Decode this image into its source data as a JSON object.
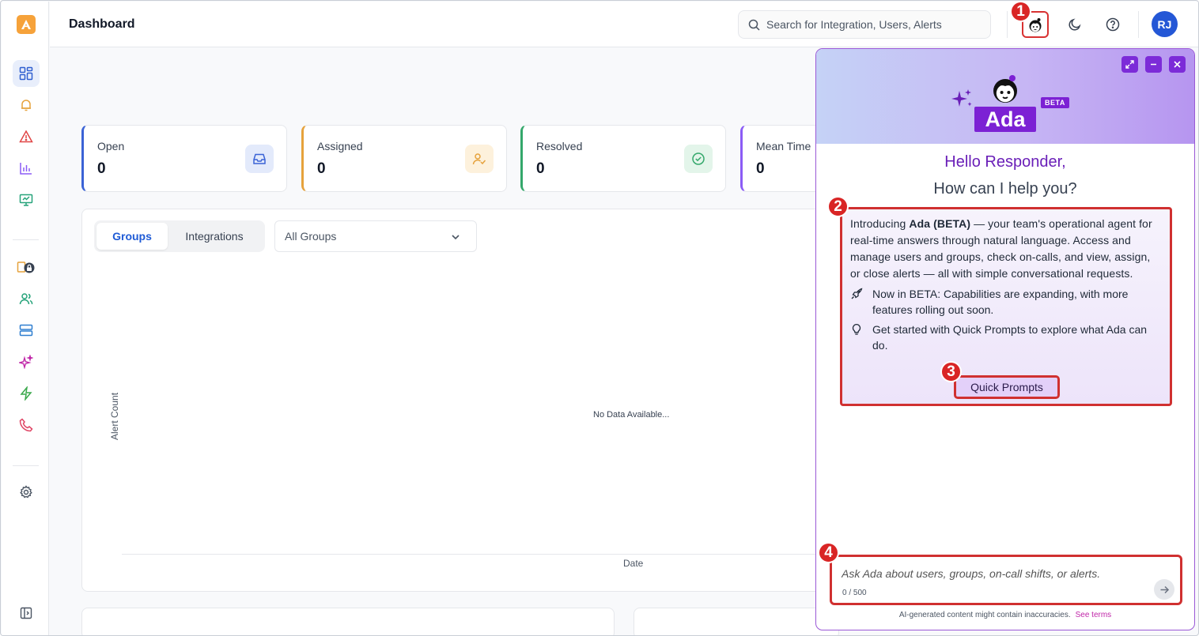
{
  "header": {
    "title": "Dashboard",
    "search_placeholder": "Search for Integration, Users, Alerts",
    "user_initials": "RJ"
  },
  "cards": [
    {
      "label": "Open",
      "value": "0",
      "color": "#3b63d6"
    },
    {
      "label": "Assigned",
      "value": "0",
      "color": "#e6a23c"
    },
    {
      "label": "Resolved",
      "value": "0",
      "color": "#34a86b"
    },
    {
      "label": "Mean Time",
      "value": "0",
      "color": "#8b5cf6"
    }
  ],
  "panel": {
    "tabs": [
      "Groups",
      "Integrations"
    ],
    "active_tab": "Groups",
    "group_select": "All Groups",
    "y_label": "Alert Count",
    "x_label": "Date",
    "empty_text": "No Data Available..."
  },
  "ada": {
    "name": "Ada",
    "beta": "BETA",
    "greeting": "Hello Responder,",
    "question": "How can I help you?",
    "intro_pre": "Introducing ",
    "intro_bold": "Ada (BETA)",
    "intro_post": " — your team's operational agent for real-time answers through natural language. Access and manage users and groups, check on-calls, and view, assign, or close alerts — all with simple conversational requests.",
    "bullet_beta": "Now in BETA: Capabilities are expanding, with more features rolling out soon.",
    "bullet_prompts": "Get started with Quick Prompts to explore what Ada can do.",
    "quick_prompts": "Quick Prompts",
    "chat_placeholder": "Ask Ada about users, groups, on-call shifts, or alerts.",
    "counter": "0 / 500",
    "disclaimer": "AI-generated content might contain inaccuracies.",
    "terms": "See terms"
  },
  "markers": [
    "1",
    "2",
    "3",
    "4"
  ]
}
